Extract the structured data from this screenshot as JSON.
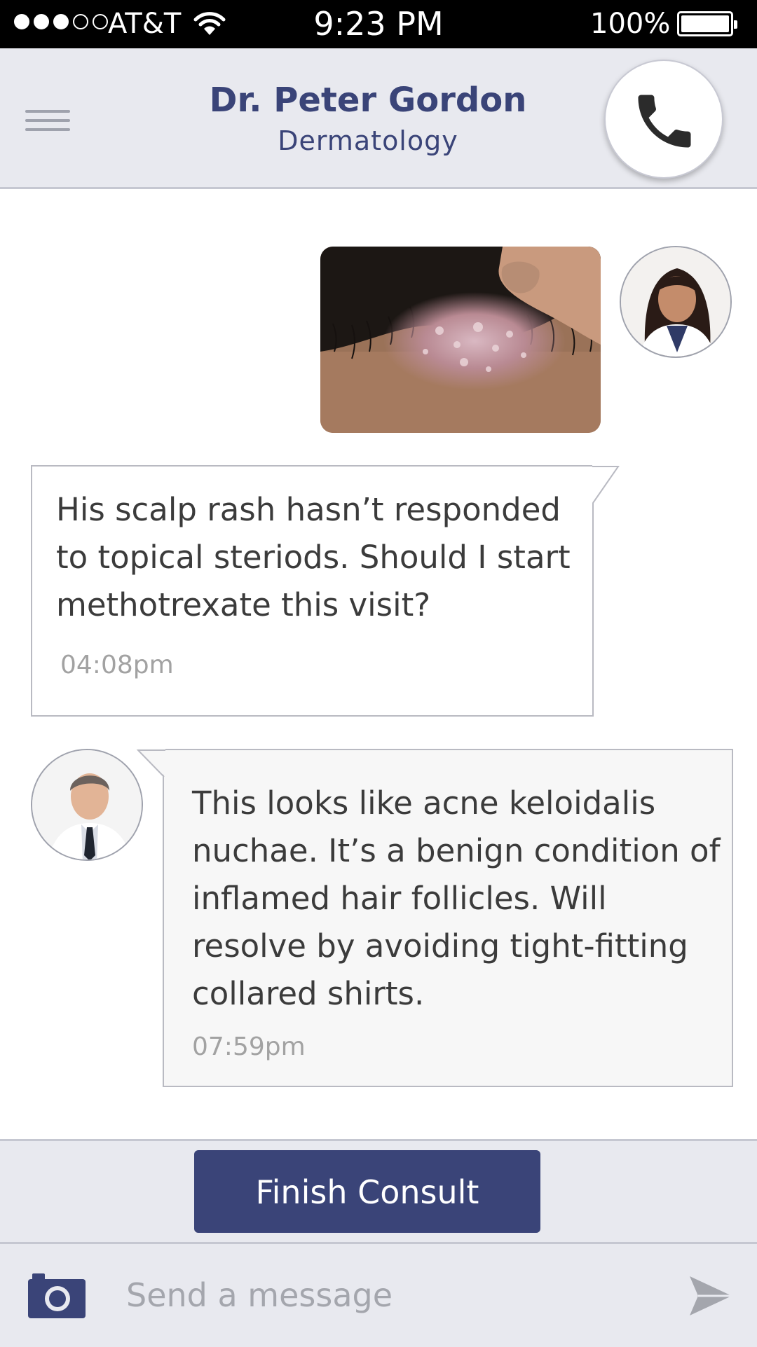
{
  "status_bar": {
    "carrier": "AT&T",
    "time": "9:23 PM",
    "battery": "100%",
    "signal_bars_filled": 3,
    "signal_bars_total": 5
  },
  "header": {
    "doctor_name": "Dr. Peter Gordon",
    "specialty": "Dermatology"
  },
  "messages": [
    {
      "type": "image",
      "subject": "scalp rash photo",
      "sender_avatar": "female clinician avatar"
    },
    {
      "type": "text",
      "text": "His scalp rash hasn’t responded to topical steriods.  Should I start methotrexate this visit?",
      "time": "04:08pm"
    },
    {
      "type": "text",
      "sender_avatar": "male doctor avatar",
      "text": "This looks like acne keloidalis nuchae. It’s a benign condition of inflamed hair follicles.  Will resolve by avoiding tight-fitting collared shirts.",
      "time": "07:59pm"
    }
  ],
  "actions": {
    "finish_consult": "Finish Consult"
  },
  "composer": {
    "placeholder": "Send a message",
    "value": ""
  },
  "icons": {
    "menu": "menu-icon",
    "call": "phone-icon",
    "camera": "camera-icon",
    "send": "send-icon"
  },
  "colors": {
    "accent": "#3a4478",
    "header_bg": "#e8e9ef",
    "bubble_border": "#b9bac2",
    "incoming_bubble_bg": "#f7f7f7",
    "timestamp": "#a2a2a2",
    "status_bar_bg": "#000000"
  }
}
